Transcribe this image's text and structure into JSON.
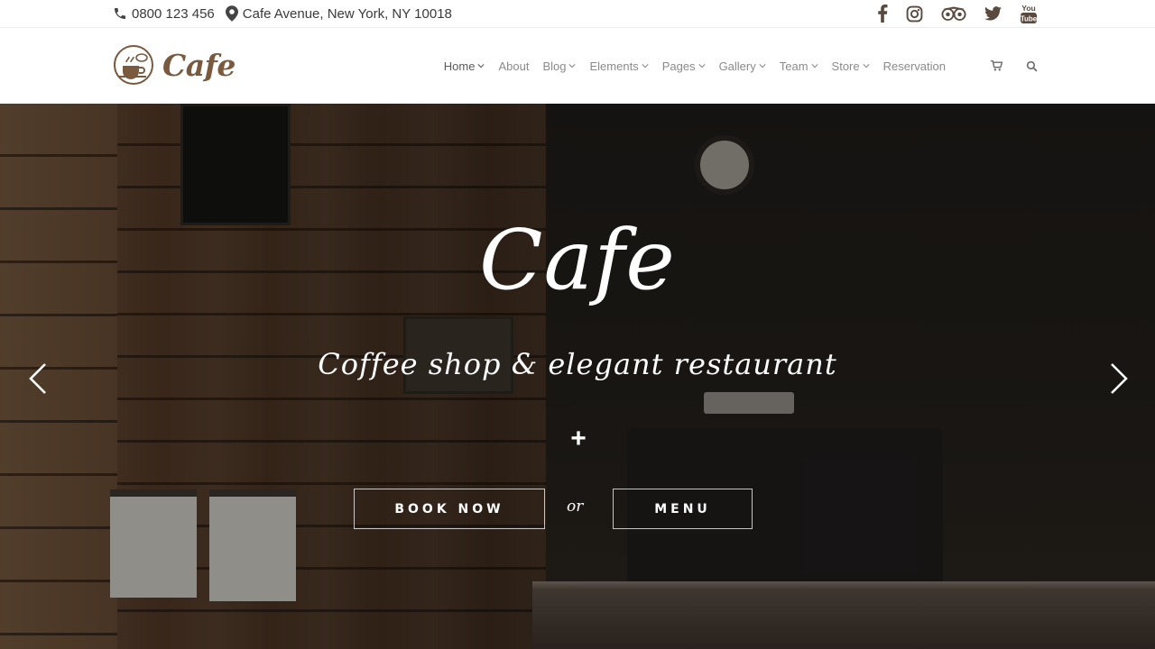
{
  "topbar": {
    "phone": "0800 123 456",
    "address": "Cafe Avenue, New York, NY 10018",
    "social": [
      "facebook-icon",
      "instagram-icon",
      "tripadvisor-icon",
      "twitter-icon",
      "youtube-icon"
    ]
  },
  "brand": {
    "name": "Cafe",
    "accent": "#7a5a3f"
  },
  "nav": {
    "items": [
      {
        "label": "Home",
        "dropdown": true,
        "active": true
      },
      {
        "label": "About",
        "dropdown": false
      },
      {
        "label": "Blog",
        "dropdown": true
      },
      {
        "label": "Elements",
        "dropdown": true
      },
      {
        "label": "Pages",
        "dropdown": true
      },
      {
        "label": "Gallery",
        "dropdown": true
      },
      {
        "label": "Team",
        "dropdown": true
      },
      {
        "label": "Store",
        "dropdown": true
      },
      {
        "label": "Reservation",
        "dropdown": false
      }
    ],
    "tools": [
      "cart-icon",
      "search-icon"
    ]
  },
  "hero": {
    "title": "Cafe",
    "subtitle": "Coffee shop & elegant restaurant",
    "plus": "+",
    "book_label": "BOOK NOW",
    "or_label": "or",
    "menu_label": "MENU"
  }
}
